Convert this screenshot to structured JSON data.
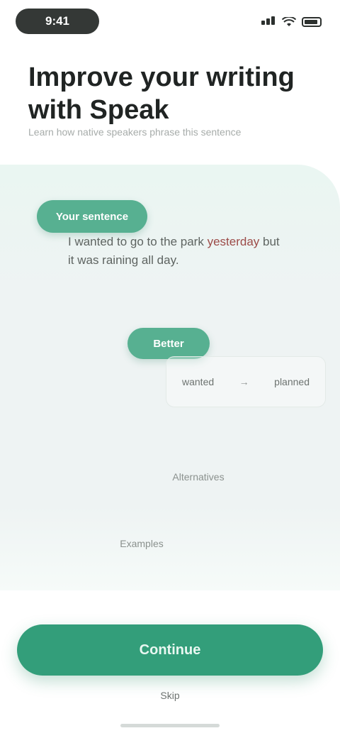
{
  "status_bar": {
    "time": "9:41"
  },
  "header": {
    "title": "Improve your writing with Speak",
    "subtitle": "Learn how native speakers phrase this sentence"
  },
  "lesson": {
    "chip_top": "Your sentence",
    "sentence_before": "I wanted to go to the park ",
    "sentence_highlight": "yesterday",
    "sentence_after": " but it was raining all day.",
    "chip_mid": "Better",
    "step_from": "wanted",
    "step_arrow": "→",
    "step_to": "planned",
    "label_mid": "Alternatives",
    "label_low": "Examples"
  },
  "footer": {
    "cta_label": "Continue",
    "secondary_link": "Skip"
  },
  "colors": {
    "accent": "#339e7a",
    "chip": "#57b091",
    "highlight": "#9c4b48",
    "background": "#eef3f3"
  },
  "icons": [
    "signal-icon",
    "wifi-icon",
    "battery-icon"
  ]
}
